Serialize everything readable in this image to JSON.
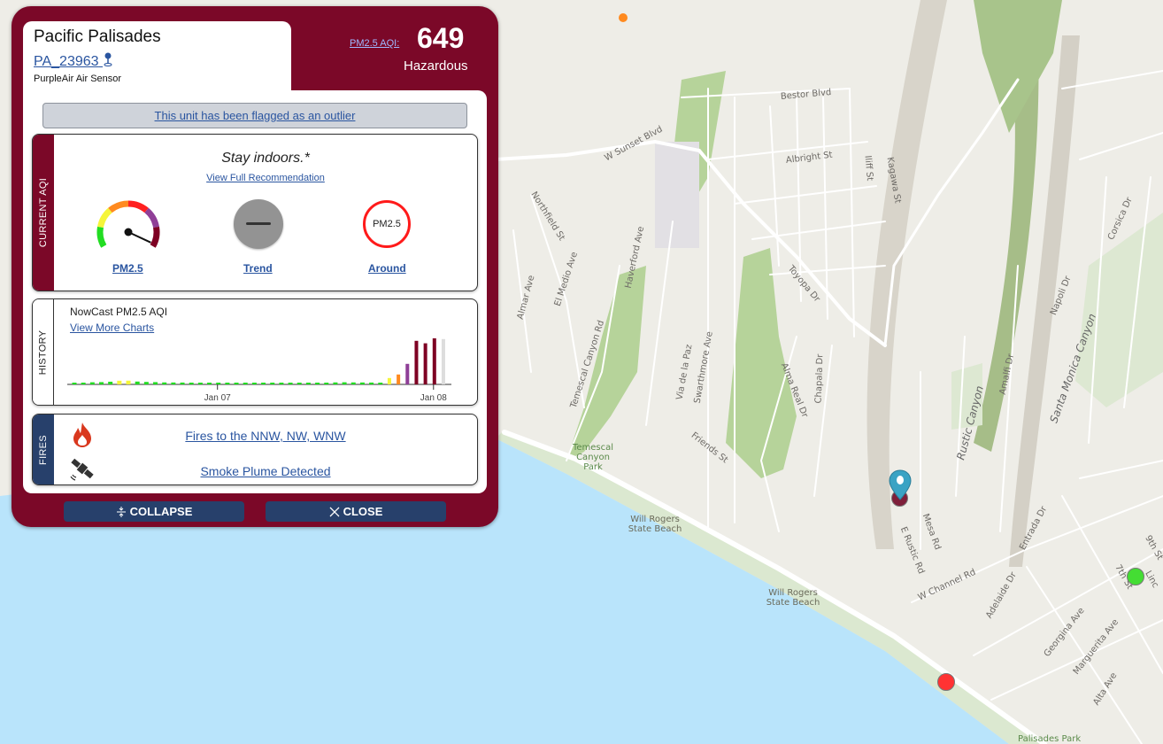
{
  "panel": {
    "location": "Pacific Palisades",
    "sensor_id": "PA_23963",
    "sensor_type": "PurpleAir Air Sensor",
    "aqi_label": "PM2.5 AQI:",
    "aqi_value": "649",
    "aqi_category": "Hazardous",
    "outlier_notice": "This unit has been flagged as an outlier",
    "theme_color": "#7b0828",
    "current_aqi": {
      "section_label": "CURRENT AQI",
      "recommendation": "Stay indoors.*",
      "recommendation_link": "View Full Recommendation",
      "gauge_label": "PM2.5",
      "gauge_level": "Hazardous",
      "trend_label": "Trend",
      "trend_icon": "dash-icon",
      "around_label": "Around",
      "around_circle_text": "PM2.5"
    },
    "history": {
      "section_label": "HISTORY",
      "title": "NowCast PM2.5 AQI",
      "link": "View More Charts"
    },
    "fires": {
      "section_label": "FIRES",
      "fire_link": "Fires to the NNW, NW, WNW",
      "smoke_link": "Smoke Plume Detected"
    },
    "buttons": {
      "collapse": "COLLAPSE",
      "close": "CLOSE"
    }
  },
  "chart_data": {
    "type": "bar",
    "title": "NowCast PM2.5 AQI",
    "x_ticks": [
      "Jan 07",
      "Jan 08"
    ],
    "values": [
      20,
      25,
      30,
      32,
      38,
      52,
      53,
      40,
      35,
      32,
      28,
      27,
      26,
      24,
      22,
      20,
      18,
      18,
      17,
      17,
      16,
      16,
      16,
      16,
      16,
      17,
      18,
      20,
      25,
      28,
      30,
      28,
      27,
      26,
      24,
      90,
      140,
      290,
      615,
      580,
      650,
      640
    ],
    "last_bar_pending": true,
    "ylim": [
      0,
      650
    ],
    "grid": false,
    "aqi_colors": {
      "good": "#22dd22",
      "moderate": "#f5f53a",
      "usg": "#ff8a1f",
      "unhealthy": "#ff2020",
      "very_unhealthy": "#8f3f97",
      "hazardous": "#7e0023",
      "pending": "#dddddd"
    }
  },
  "map": {
    "labels": [
      "Bestor Blvd",
      "W Sunset Blvd",
      "Albright St",
      "Iliff St",
      "Kagawa St",
      "Northfield St",
      "Corsica Dr",
      "Haverford Ave",
      "El Medio Ave",
      "Almar Ave",
      "Toyopa Dr",
      "Temescal Canyon Rd",
      "Via de la Paz",
      "Swarthmore Ave",
      "Alma Real Dr",
      "Chapala Dr",
      "Napoli Dr",
      "Santa Monica Canyon",
      "Rustic Canyon",
      "Amalfi Dr",
      "Friends St",
      "E Rustic Rd",
      "Mesa Rd",
      "Entrada Dr",
      "W Channel Rd",
      "Adelaide Dr",
      "7th St",
      "Georgina Ave",
      "Marguerita Ave",
      "Alta Ave",
      "9th St",
      "Linc"
    ],
    "parks": [
      "Temescal Canyon Park",
      "Palisades Park"
    ],
    "beaches": [
      "Will Rogers State Beach",
      "Will Rogers State Beach"
    ],
    "markers": [
      {
        "type": "selected-pin",
        "color": "#3aa3c4"
      },
      {
        "type": "sensor",
        "color": "#7e1f3a"
      },
      {
        "type": "sensor",
        "color": "#44dd33"
      },
      {
        "type": "sensor",
        "color": "#ff3333"
      },
      {
        "type": "sensor",
        "color": "#ff8a1f"
      }
    ]
  }
}
